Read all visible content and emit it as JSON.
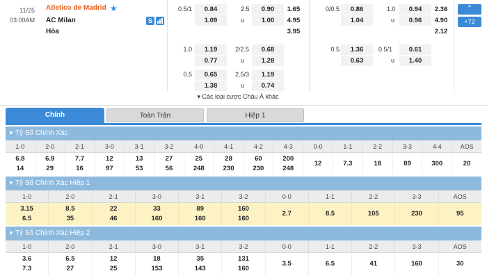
{
  "match": {
    "date": "11/25",
    "time": "03:00AM",
    "home": "Atletico de Madrid",
    "away": "AC Milan",
    "draw": "Hòa",
    "live_badge": "S",
    "more_count": "+72",
    "more_bets": "▾ Các loại cược Châu Á khác"
  },
  "odds": {
    "ft_hdp": [
      {
        "line": "0.5/1",
        "home": "0.84",
        "away": "1.09"
      },
      {
        "line": "1.0",
        "home": "1.19",
        "away": "0.77"
      },
      {
        "line": "0.5",
        "home": "0.65",
        "away": "1.38"
      }
    ],
    "ft_ou": [
      {
        "line": "2.5",
        "over": "0.90",
        "u": "u",
        "under": "1.00"
      },
      {
        "line": "2/2.5",
        "over": "0.68",
        "u": "u",
        "under": "1.28"
      },
      {
        "line": "2.5/3",
        "over": "1.19",
        "u": "u",
        "under": "0.74"
      }
    ],
    "ft_1x2": [
      "1.65",
      "4.95",
      "3.95"
    ],
    "h1_hdp": [
      {
        "line": "0/0.5",
        "home": "0.86",
        "away": "1.04"
      },
      {
        "line": "0.5",
        "home": "1.36",
        "away": "0.63"
      }
    ],
    "h1_ou": [
      {
        "line": "1.0",
        "over": "0.94",
        "u": "u",
        "under": "0.96"
      },
      {
        "line": "0.5/1",
        "over": "0.61",
        "u": "u",
        "under": "1.40"
      }
    ],
    "h1_1x2": [
      "2.36",
      "4.90",
      "2.12"
    ]
  },
  "tabs": [
    "Chính",
    "Toàn Trận",
    "Hiệp 1"
  ],
  "sections": [
    {
      "title": "Tỷ Số Chính Xác",
      "headers": [
        "1-0",
        "2-0",
        "2-1",
        "3-0",
        "3-1",
        "3-2",
        "4-0",
        "4-1",
        "4-2",
        "4-3",
        "0-0",
        "1-1",
        "2-2",
        "3-3",
        "4-4",
        "AOS"
      ],
      "top": [
        "6.8",
        "6.9",
        "7.7",
        "12",
        "13",
        "27",
        "25",
        "28",
        "60",
        "200",
        "12",
        "7.3",
        "18",
        "89",
        "300",
        "20"
      ],
      "bottom": [
        "14",
        "29",
        "16",
        "97",
        "53",
        "56",
        "248",
        "230",
        "230",
        "248",
        "",
        "",
        "",
        "",
        "",
        ""
      ]
    },
    {
      "title": "Tỷ Số Chính Xác Hiệp 1",
      "headers": [
        "1-0",
        "2-0",
        "2-1",
        "3-0",
        "3-1",
        "3-2",
        "0-0",
        "1-1",
        "2-2",
        "3-3",
        "AOS"
      ],
      "top": [
        "3.15",
        "8.5",
        "22",
        "33",
        "89",
        "160",
        "2.7",
        "8.5",
        "105",
        "230",
        "95"
      ],
      "bottom": [
        "6.5",
        "35",
        "46",
        "160",
        "160",
        "160",
        "",
        "",
        "",
        "",
        ""
      ]
    },
    {
      "title": "Tỷ Số Chính Xác Hiệp 2",
      "headers": [
        "1-0",
        "2-0",
        "2-1",
        "3-0",
        "3-1",
        "3-2",
        "0-0",
        "1-1",
        "2-2",
        "3-3",
        "AOS"
      ],
      "top": [
        "3.6",
        "6.5",
        "12",
        "18",
        "35",
        "131",
        "3.5",
        "6.5",
        "41",
        "160",
        "30"
      ],
      "bottom": [
        "7.3",
        "27",
        "25",
        "153",
        "143",
        "160",
        "",
        "",
        "",
        "",
        ""
      ]
    }
  ]
}
